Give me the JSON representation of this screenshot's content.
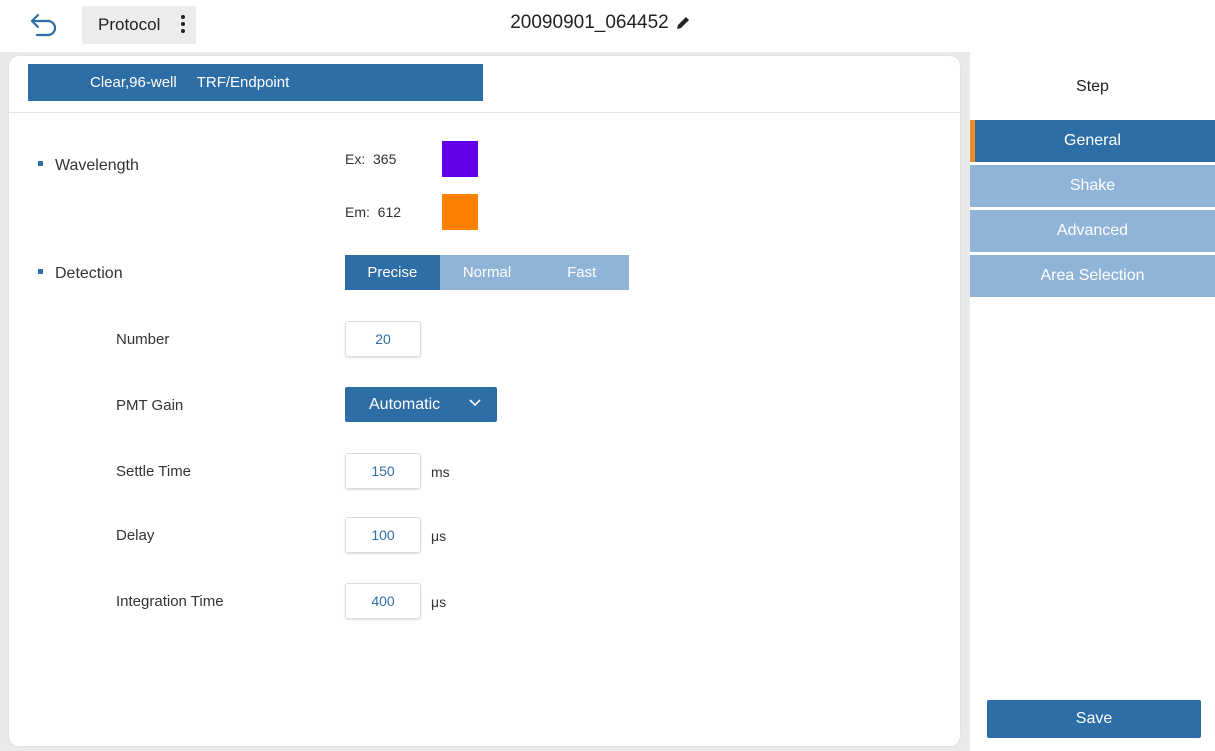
{
  "header": {
    "protocol_label": "Protocol",
    "title": "20090901_064452"
  },
  "tag_bar": {
    "plate": "Clear,96-well",
    "mode": "TRF/Endpoint"
  },
  "wavelength": {
    "label": "Wavelength",
    "ex_label": "Ex:",
    "ex_value": "365",
    "ex_color": "#6200ea",
    "em_label": "Em:",
    "em_value": "612",
    "em_color": "#ff7f00"
  },
  "detection": {
    "label": "Detection",
    "modes": [
      "Precise",
      "Normal",
      "Fast"
    ],
    "selected": "Precise"
  },
  "fields": {
    "number_label": "Number",
    "number_value": "20",
    "pmt_label": "PMT Gain",
    "pmt_value": "Automatic",
    "settle_label": "Settle Time",
    "settle_value": "150",
    "settle_unit": "ms",
    "delay_label": "Delay",
    "delay_value": "100",
    "delay_unit": "μs",
    "integration_label": "Integration Time",
    "integration_value": "400",
    "integration_unit": "μs"
  },
  "side": {
    "title": "Step",
    "items": [
      "General",
      "Shake",
      "Advanced",
      "Area Selection"
    ],
    "active": "General",
    "save_label": "Save"
  },
  "colors": {
    "primary": "#2d6ea6",
    "inactive": "#8fb4d8",
    "accent": "#f28a2e"
  }
}
